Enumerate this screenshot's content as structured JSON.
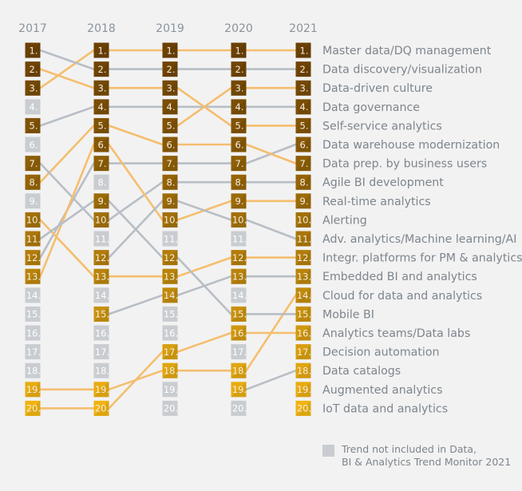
{
  "chart_data": {
    "type": "bump",
    "title": "",
    "years": [
      "2017",
      "2018",
      "2019",
      "2020",
      "2021"
    ],
    "ranks": 20,
    "trends": [
      {
        "label": "Master data/DQ management",
        "ranks": [
          3,
          1,
          1,
          1,
          1
        ],
        "line": "orange"
      },
      {
        "label": "Data discovery/visualization",
        "ranks": [
          1,
          2,
          2,
          2,
          2
        ],
        "line": "gray"
      },
      {
        "label": "Data-driven culture",
        "ranks": [
          null,
          null,
          5,
          3,
          3
        ],
        "line": "orange"
      },
      {
        "label": "Data governance",
        "ranks": [
          5,
          4,
          4,
          4,
          4
        ],
        "line": "gray"
      },
      {
        "label": "Self-service analytics",
        "ranks": [
          2,
          3,
          3,
          5,
          5
        ],
        "line": "orange"
      },
      {
        "label": "Data warehouse modernization",
        "ranks": [
          12,
          7,
          7,
          7,
          6
        ],
        "line": "gray"
      },
      {
        "label": "Data prep. by business users",
        "ranks": [
          8,
          5,
          6,
          6,
          7
        ],
        "line": "orange"
      },
      {
        "label": "Agile BI development",
        "ranks": [
          7,
          10,
          8,
          8,
          8
        ],
        "line": "gray"
      },
      {
        "label": "Real-time analytics",
        "ranks": [
          13,
          6,
          10,
          9,
          9
        ],
        "line": "orange"
      },
      {
        "label": "Alerting",
        "ranks": [
          null,
          null,
          null,
          null,
          10
        ],
        "line": "gray"
      },
      {
        "label": "Adv. analytics/Machine learning/AI",
        "ranks": [
          null,
          12,
          9,
          10,
          11
        ],
        "line": "gray"
      },
      {
        "label": "Integr. platforms for PM & analytics",
        "ranks": [
          10,
          13,
          13,
          12,
          12
        ],
        "line": "orange"
      },
      {
        "label": "Embedded BI and analytics",
        "ranks": [
          null,
          15,
          14,
          13,
          13
        ],
        "line": "gray"
      },
      {
        "label": "Cloud for data and analytics",
        "ranks": [
          19,
          19,
          18,
          18,
          14
        ],
        "line": "orange"
      },
      {
        "label": "Mobile BI",
        "ranks": [
          11,
          9,
          12,
          15,
          15
        ],
        "line": "gray"
      },
      {
        "label": "Analytics teams/Data labs",
        "ranks": [
          20,
          20,
          17,
          16,
          16
        ],
        "line": "orange"
      },
      {
        "label": "Decision automation",
        "ranks": [
          null,
          null,
          null,
          null,
          17
        ],
        "line": "orange"
      },
      {
        "label": "Data catalogs",
        "ranks": [
          null,
          null,
          null,
          19,
          18
        ],
        "line": "gray"
      },
      {
        "label": "Augmented analytics",
        "ranks": [
          null,
          null,
          null,
          null,
          19
        ],
        "line": "orange"
      },
      {
        "label": "IoT data and analytics",
        "ranks": [
          null,
          null,
          null,
          null,
          20
        ],
        "line": "orange"
      }
    ],
    "colors": {
      "line_orange": "#f5be6e",
      "line_gray": "#b8bec5",
      "inactive_box": "#c9ccd0",
      "box_top": "#6b4003",
      "box_bottom": "#f0b311"
    },
    "legend": {
      "entries": [
        {
          "swatch": "gray",
          "text": "Trend not included in Data, BI & Analytics Trend Monitor 2021"
        }
      ],
      "placement": "bottom-right"
    }
  },
  "legend": {
    "line1": "Trend not included in Data,",
    "line2": "BI & Analytics Trend Monitor 2021"
  }
}
